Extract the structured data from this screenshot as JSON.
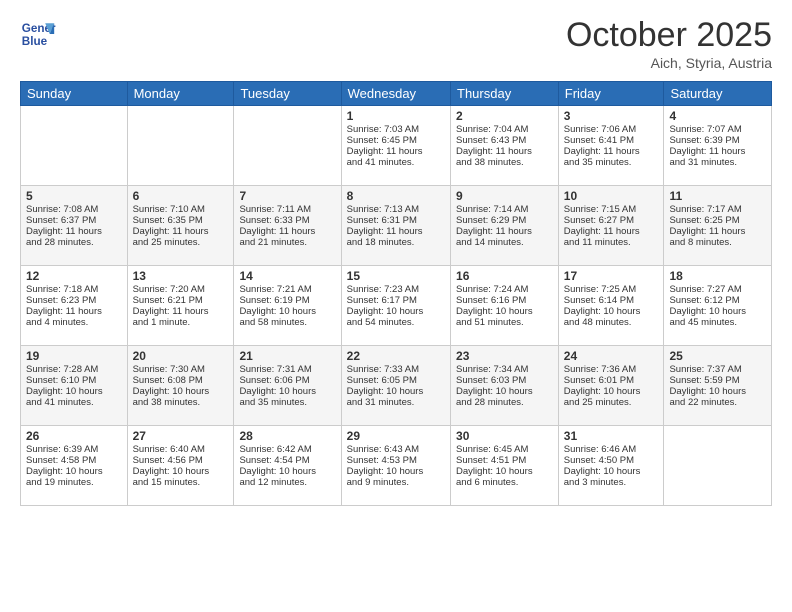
{
  "header": {
    "logo_line1": "General",
    "logo_line2": "Blue",
    "month": "October 2025",
    "location": "Aich, Styria, Austria"
  },
  "weekdays": [
    "Sunday",
    "Monday",
    "Tuesday",
    "Wednesday",
    "Thursday",
    "Friday",
    "Saturday"
  ],
  "weeks": [
    [
      {
        "day": "",
        "content": ""
      },
      {
        "day": "",
        "content": ""
      },
      {
        "day": "",
        "content": ""
      },
      {
        "day": "1",
        "content": "Sunrise: 7:03 AM\nSunset: 6:45 PM\nDaylight: 11 hours\nand 41 minutes."
      },
      {
        "day": "2",
        "content": "Sunrise: 7:04 AM\nSunset: 6:43 PM\nDaylight: 11 hours\nand 38 minutes."
      },
      {
        "day": "3",
        "content": "Sunrise: 7:06 AM\nSunset: 6:41 PM\nDaylight: 11 hours\nand 35 minutes."
      },
      {
        "day": "4",
        "content": "Sunrise: 7:07 AM\nSunset: 6:39 PM\nDaylight: 11 hours\nand 31 minutes."
      }
    ],
    [
      {
        "day": "5",
        "content": "Sunrise: 7:08 AM\nSunset: 6:37 PM\nDaylight: 11 hours\nand 28 minutes."
      },
      {
        "day": "6",
        "content": "Sunrise: 7:10 AM\nSunset: 6:35 PM\nDaylight: 11 hours\nand 25 minutes."
      },
      {
        "day": "7",
        "content": "Sunrise: 7:11 AM\nSunset: 6:33 PM\nDaylight: 11 hours\nand 21 minutes."
      },
      {
        "day": "8",
        "content": "Sunrise: 7:13 AM\nSunset: 6:31 PM\nDaylight: 11 hours\nand 18 minutes."
      },
      {
        "day": "9",
        "content": "Sunrise: 7:14 AM\nSunset: 6:29 PM\nDaylight: 11 hours\nand 14 minutes."
      },
      {
        "day": "10",
        "content": "Sunrise: 7:15 AM\nSunset: 6:27 PM\nDaylight: 11 hours\nand 11 minutes."
      },
      {
        "day": "11",
        "content": "Sunrise: 7:17 AM\nSunset: 6:25 PM\nDaylight: 11 hours\nand 8 minutes."
      }
    ],
    [
      {
        "day": "12",
        "content": "Sunrise: 7:18 AM\nSunset: 6:23 PM\nDaylight: 11 hours\nand 4 minutes."
      },
      {
        "day": "13",
        "content": "Sunrise: 7:20 AM\nSunset: 6:21 PM\nDaylight: 11 hours\nand 1 minute."
      },
      {
        "day": "14",
        "content": "Sunrise: 7:21 AM\nSunset: 6:19 PM\nDaylight: 10 hours\nand 58 minutes."
      },
      {
        "day": "15",
        "content": "Sunrise: 7:23 AM\nSunset: 6:17 PM\nDaylight: 10 hours\nand 54 minutes."
      },
      {
        "day": "16",
        "content": "Sunrise: 7:24 AM\nSunset: 6:16 PM\nDaylight: 10 hours\nand 51 minutes."
      },
      {
        "day": "17",
        "content": "Sunrise: 7:25 AM\nSunset: 6:14 PM\nDaylight: 10 hours\nand 48 minutes."
      },
      {
        "day": "18",
        "content": "Sunrise: 7:27 AM\nSunset: 6:12 PM\nDaylight: 10 hours\nand 45 minutes."
      }
    ],
    [
      {
        "day": "19",
        "content": "Sunrise: 7:28 AM\nSunset: 6:10 PM\nDaylight: 10 hours\nand 41 minutes."
      },
      {
        "day": "20",
        "content": "Sunrise: 7:30 AM\nSunset: 6:08 PM\nDaylight: 10 hours\nand 38 minutes."
      },
      {
        "day": "21",
        "content": "Sunrise: 7:31 AM\nSunset: 6:06 PM\nDaylight: 10 hours\nand 35 minutes."
      },
      {
        "day": "22",
        "content": "Sunrise: 7:33 AM\nSunset: 6:05 PM\nDaylight: 10 hours\nand 31 minutes."
      },
      {
        "day": "23",
        "content": "Sunrise: 7:34 AM\nSunset: 6:03 PM\nDaylight: 10 hours\nand 28 minutes."
      },
      {
        "day": "24",
        "content": "Sunrise: 7:36 AM\nSunset: 6:01 PM\nDaylight: 10 hours\nand 25 minutes."
      },
      {
        "day": "25",
        "content": "Sunrise: 7:37 AM\nSunset: 5:59 PM\nDaylight: 10 hours\nand 22 minutes."
      }
    ],
    [
      {
        "day": "26",
        "content": "Sunrise: 6:39 AM\nSunset: 4:58 PM\nDaylight: 10 hours\nand 19 minutes."
      },
      {
        "day": "27",
        "content": "Sunrise: 6:40 AM\nSunset: 4:56 PM\nDaylight: 10 hours\nand 15 minutes."
      },
      {
        "day": "28",
        "content": "Sunrise: 6:42 AM\nSunset: 4:54 PM\nDaylight: 10 hours\nand 12 minutes."
      },
      {
        "day": "29",
        "content": "Sunrise: 6:43 AM\nSunset: 4:53 PM\nDaylight: 10 hours\nand 9 minutes."
      },
      {
        "day": "30",
        "content": "Sunrise: 6:45 AM\nSunset: 4:51 PM\nDaylight: 10 hours\nand 6 minutes."
      },
      {
        "day": "31",
        "content": "Sunrise: 6:46 AM\nSunset: 4:50 PM\nDaylight: 10 hours\nand 3 minutes."
      },
      {
        "day": "",
        "content": ""
      }
    ]
  ]
}
